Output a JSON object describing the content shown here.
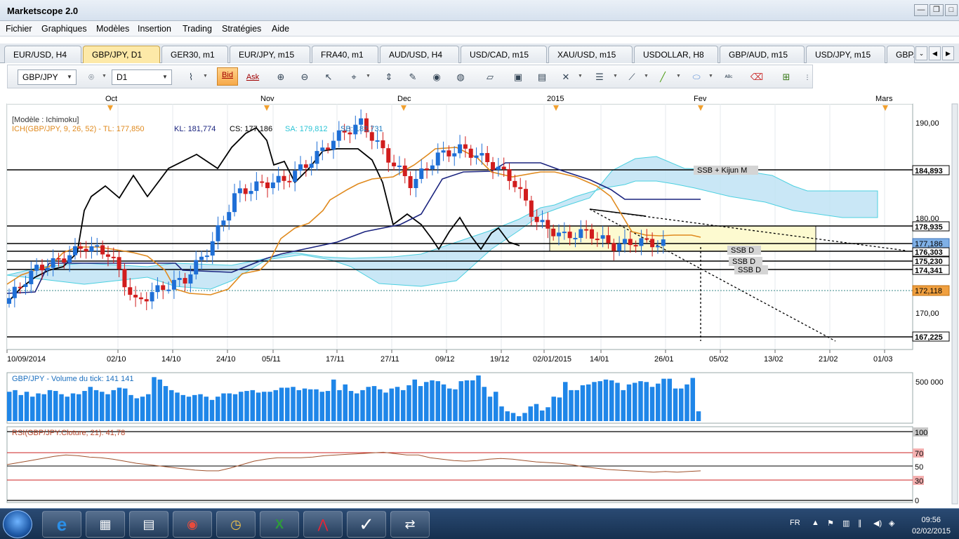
{
  "app": {
    "title": "Marketscope 2.0",
    "restore_icon": "restore-icon",
    "minimize_icon": "minimize-icon",
    "close_icon": "close-icon"
  },
  "menu": [
    "Fichier",
    "Graphiques",
    "Modèles",
    "Insertion",
    "Trading",
    "Stratégies",
    "Aide"
  ],
  "tabs": [
    "EUR/USD, H4",
    "GBP/JPY, D1",
    "GER30, m1",
    "EUR/JPY, m15",
    "FRA40, m1",
    "AUD/USD, H4",
    "USD/CAD, m15",
    "XAU/USD, m15",
    "USDOLLAR, H8",
    "GBP/AUD, m15",
    "USD/JPY, m15",
    "GBP/"
  ],
  "active_tab": "GBP/JPY, D1",
  "toolbar": {
    "symbol": "GBP/JPY",
    "timeframe": "D1",
    "bid_label": "Bid",
    "ask_label": "Ask"
  },
  "chart": {
    "model_label": "[Modèle : Ichimoku]",
    "ichimoku_label": "ICH(GBP/JPY, 9, 26, 52) -  TL: 177,850",
    "kl_label": "KL: 181,774",
    "cs_label": "CS: 177,186",
    "sa_label": "SA: 179,812",
    "sb_label": "SB: 182,731",
    "months": [
      "Oct",
      "Nov",
      "Dec",
      "2015",
      "Fev",
      "Mars"
    ],
    "date_ticks": [
      "10/09/2014",
      "02/10",
      "14/10",
      "24/10",
      "05/11",
      "17/11",
      "27/11",
      "09/12",
      "19/12",
      "02/01/2015",
      "14/01",
      "26/01",
      "05/02",
      "13/02",
      "21/02",
      "01/03"
    ],
    "price_ticks": [
      "190,00",
      "180,00",
      "170,00"
    ],
    "level_labels": [
      "184,893",
      "178,935",
      "177,186",
      "176,303",
      "175,230",
      "174,341",
      "172,118",
      "167,225"
    ],
    "annotations": [
      "SSB + Kijun M",
      "SSB D",
      "SSB D",
      "SSB D"
    ],
    "volume_label": "GBP/JPY - Volume du tick: 141 141",
    "volume_tick": "500 000",
    "rsi_label": "RSI(GBP/JPY.Cloture, 21): 41,78",
    "rsi_ticks": [
      "100",
      "70",
      "50",
      "30",
      "0"
    ]
  },
  "chart_data": [
    {
      "type": "candlestick",
      "title": "GBP/JPY, D1",
      "ylim": [
        165,
        192
      ],
      "x_range": [
        "10/09/2014",
        "04/03/2015"
      ],
      "price_levels": [
        184.893,
        178.935,
        177.186,
        176.303,
        175.23,
        174.341,
        172.118,
        167.225
      ],
      "last_close": 177.186,
      "ichimoku": {
        "tenkan": 177.85,
        "kijun": 181.774,
        "chikou": 177.186,
        "senkou_a": 179.812,
        "senkou_b": 182.731
      },
      "close_path": [
        [
          "10/09/2014",
          171.5
        ],
        [
          "17/09",
          174.5
        ],
        [
          "24/09",
          175.5
        ],
        [
          "30/09",
          177.0
        ],
        [
          "06/10",
          176.2
        ],
        [
          "14/10",
          171.0
        ],
        [
          "20/10",
          172.5
        ],
        [
          "27/10",
          173.5
        ],
        [
          "03/11",
          177.0
        ],
        [
          "06/11",
          182.5
        ],
        [
          "13/11",
          183.5
        ],
        [
          "20/11",
          184.0
        ],
        [
          "27/11",
          186.0
        ],
        [
          "03/12",
          188.5
        ],
        [
          "08/12",
          190.0
        ],
        [
          "12/12",
          186.5
        ],
        [
          "17/12",
          183.5
        ],
        [
          "22/12",
          186.5
        ],
        [
          "29/12",
          187.3
        ],
        [
          "02/01/2015",
          186.0
        ],
        [
          "07/01",
          184.0
        ],
        [
          "12/01",
          179.5
        ],
        [
          "16/01",
          178.0
        ],
        [
          "21/01",
          178.5
        ],
        [
          "26/01",
          177.0
        ],
        [
          "30/01",
          177.5
        ],
        [
          "02/02",
          177.186
        ]
      ]
    },
    {
      "type": "bar",
      "title": "GBP/JPY - Volume du tick",
      "last_value": 141141,
      "ylim": [
        0,
        550000
      ],
      "values": [
        360000,
        380000,
        320000,
        360000,
        300000,
        340000,
        330000,
        380000,
        370000,
        330000,
        300000,
        340000,
        330000,
        370000,
        420000,
        380000,
        360000,
        330000,
        380000,
        410000,
        400000,
        320000,
        280000,
        300000,
        330000,
        540000,
        510000,
        430000,
        380000,
        350000,
        320000,
        300000,
        320000,
        330000,
        300000,
        260000,
        300000,
        340000,
        340000,
        330000,
        360000,
        370000,
        380000,
        350000,
        360000,
        360000,
        380000,
        410000,
        410000,
        420000,
        380000,
        400000,
        390000,
        390000,
        360000,
        370000,
        510000,
        380000,
        450000,
        370000,
        340000,
        380000,
        420000,
        430000,
        390000,
        350000,
        400000,
        420000,
        380000,
        440000,
        510000,
        430000,
        480000,
        500000,
        490000,
        450000,
        400000,
        390000,
        490000,
        500000,
        500000,
        560000,
        420000,
        300000,
        360000,
        180000,
        120000,
        100000,
        60000,
        100000,
        180000,
        210000,
        130000,
        170000,
        300000,
        290000,
        480000,
        380000,
        380000,
        440000,
        450000,
        480000,
        490000,
        510000,
        500000,
        470000,
        380000,
        450000,
        470000,
        490000,
        480000,
        420000,
        460000,
        520000,
        520000,
        400000,
        400000,
        450000,
        530000,
        120000
      ]
    },
    {
      "type": "line",
      "title": "RSI(GBP/JPY.Cloture, 21)",
      "last_value": 41.78,
      "ylim": [
        0,
        100
      ],
      "levels": [
        70,
        50,
        30
      ],
      "values": [
        52,
        55,
        58,
        61,
        64,
        66,
        65,
        63,
        62,
        60,
        57,
        54,
        52,
        50,
        48,
        46,
        44,
        43,
        43,
        47,
        52,
        57,
        60,
        62,
        62,
        62,
        63,
        65,
        66,
        67,
        68,
        69,
        70,
        68,
        66,
        66,
        62,
        60,
        58,
        57,
        58,
        60,
        61,
        60,
        58,
        56,
        55,
        54,
        52,
        49,
        47,
        45,
        44,
        43,
        42,
        41,
        42,
        41,
        42,
        43
      ]
    }
  ]
}
